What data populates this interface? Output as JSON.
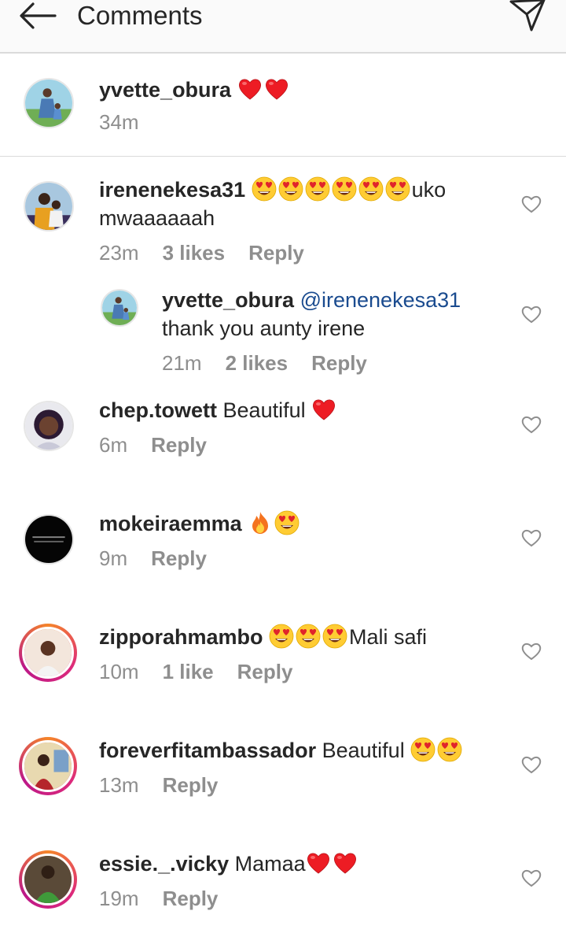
{
  "header": {
    "title": "Comments",
    "back_icon": "arrow-left-icon",
    "send_icon": "paper-plane-icon"
  },
  "caption": {
    "username": "yvette_obura",
    "text": "",
    "emoji": [
      "red-heart",
      "red-heart"
    ],
    "time": "34m"
  },
  "comments": [
    {
      "username": "irenenekesa31",
      "emoji_before": [
        "heart-eyes",
        "heart-eyes",
        "heart-eyes",
        "heart-eyes",
        "heart-eyes",
        "heart-eyes"
      ],
      "text_after_emoji": "uko",
      "text_line2": "mwaaaaaah",
      "time": "23m",
      "likes": "3 likes",
      "reply": "Reply"
    },
    {
      "username": "yvette_obura",
      "mention": "@irenenekesa31",
      "text_line2": "thank you aunty irene",
      "time": "21m",
      "likes": "2 likes",
      "reply": "Reply",
      "is_reply": true
    },
    {
      "username": "chep.towett",
      "text": "Beautiful",
      "emoji_after": [
        "red-heart"
      ],
      "time": "6m",
      "reply": "Reply"
    },
    {
      "username": "mokeiraemma",
      "emoji_after": [
        "fire",
        "heart-eyes"
      ],
      "time": "9m",
      "reply": "Reply"
    },
    {
      "username": "zipporahmambo",
      "emoji_after": [
        "heart-eyes",
        "heart-eyes",
        "heart-eyes"
      ],
      "text_end": "Mali safi",
      "time": "10m",
      "likes": "1 like",
      "reply": "Reply"
    },
    {
      "username": "foreverfitambassador",
      "text": "Beautiful",
      "emoji_after": [
        "heart-eyes",
        "heart-eyes"
      ],
      "time": "13m",
      "reply": "Reply"
    },
    {
      "username": "essie._.vicky",
      "text": "Mamaa",
      "emoji_after": [
        "red-heart",
        "red-heart"
      ],
      "time": "19m",
      "reply": "Reply"
    }
  ],
  "colors": {
    "text": "#262626",
    "meta": "#8e8e8e",
    "mention": "#1a4b8f",
    "heart": "#ed1c24",
    "divider": "#dbdbdb"
  }
}
